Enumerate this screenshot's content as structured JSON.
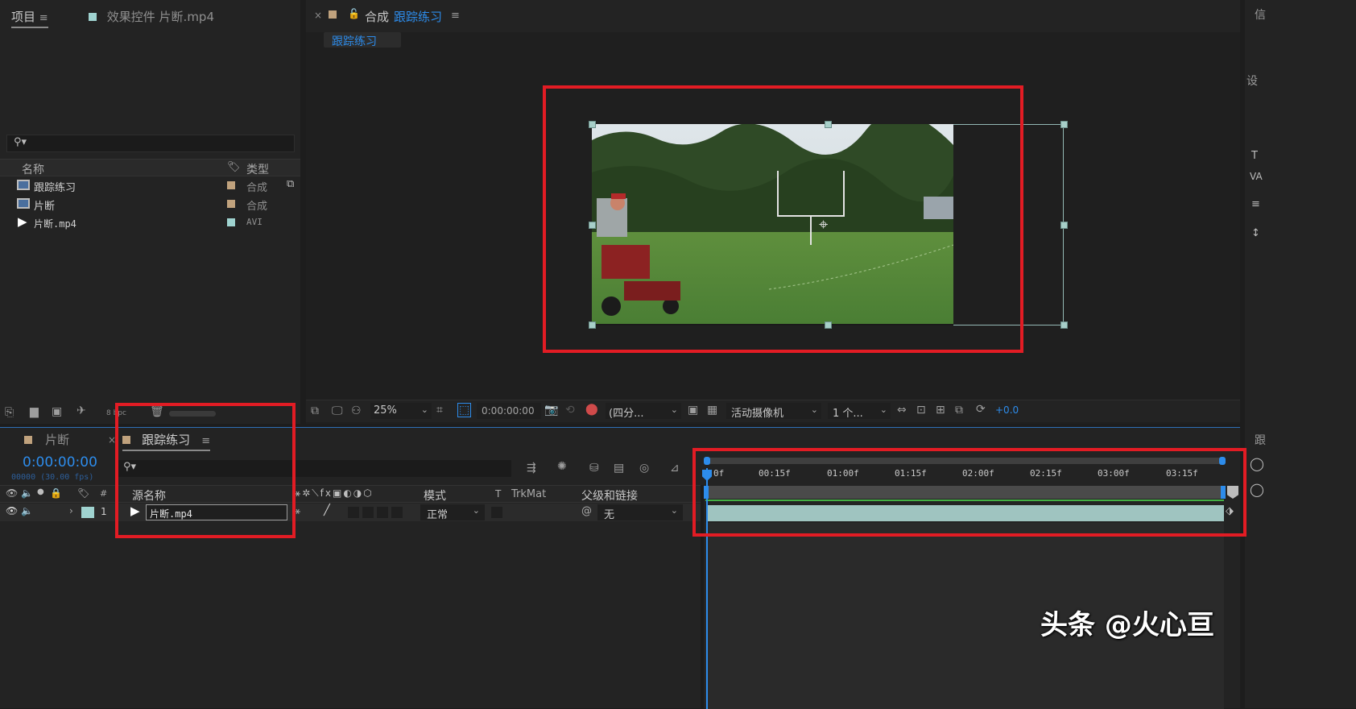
{
  "project_panel": {
    "tab_label": "项目",
    "effects_tab_label": "效果控件 片断.mp4",
    "search_icon": "search-icon",
    "col_name": "名称",
    "col_type": "类型",
    "items": [
      {
        "name": "跟踪练习",
        "type": "合成",
        "color": "#c0a27d"
      },
      {
        "name": "片断",
        "type": "合成",
        "color": "#c0a27d"
      },
      {
        "name": "片断.mp4",
        "type": "AVI",
        "color": "#9fd3d0"
      }
    ],
    "bit_depth": "8 bpc"
  },
  "comp_panel": {
    "close": "×",
    "title_prefix": "合成",
    "title_name": "跟踪练习",
    "breadcrumb": "跟踪练习",
    "zoom": "25%",
    "timecode": "0:00:00:00",
    "resolution": "(四分...",
    "camera": "活动摄像机",
    "views": "1 个...",
    "exposure": "+0.0"
  },
  "timeline": {
    "tab_other": "片断",
    "tab_active": "跟踪练习",
    "timecode": "0:00:00:00",
    "sub_timecode": "00000 (30.00 fps)",
    "col_num": "#",
    "col_source": "源名称",
    "col_mode": "模式",
    "col_t": "T",
    "col_trkmat": "TrkMat",
    "col_parent": "父级和链接",
    "layer": {
      "num": "1",
      "name": "片断.mp4",
      "mode": "正常",
      "parent": "无",
      "color": "#9fd3d0"
    },
    "ticks": [
      "0f",
      "00:15f",
      "01:00f",
      "01:15f",
      "02:00f",
      "02:15f",
      "03:00f",
      "03:15f"
    ]
  },
  "right_panel": {
    "label_top": "信",
    "label_set": "设",
    "label_track": "跟"
  },
  "watermark": "头条 @火心亘",
  "colors": {
    "accent_blue": "#2d8ceb",
    "red_box": "#e21c24",
    "layer_bar": "#9fc4c0"
  }
}
